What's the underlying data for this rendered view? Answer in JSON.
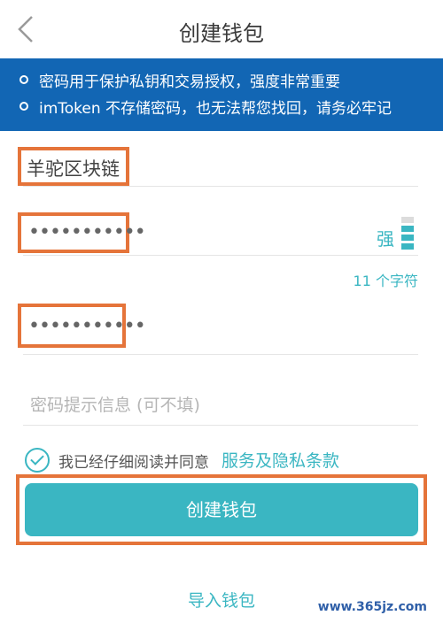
{
  "header": {
    "title": "创建钱包",
    "back_icon": "chevron-left-icon"
  },
  "notice": {
    "items": [
      "密码用于保护私钥和交易授权，强度非常重要",
      "imToken 不存储密码，也无法帮您找回，请务必牢记"
    ],
    "background": "#1266b4"
  },
  "form": {
    "wallet_name": "羊驼区块链",
    "password_masked": "•••••••••••",
    "password_strength": "强",
    "password_strength_level": 3,
    "password_length_text": "11 个字符",
    "confirm_password_masked": "•••••••••••",
    "hint_placeholder": "密码提示信息 (可不填)"
  },
  "agreement": {
    "checked": true,
    "text": "我已经仔细阅读并同意",
    "link_text": "服务及隐私条款"
  },
  "buttons": {
    "create_label": "创建钱包",
    "import_label": "导入钱包"
  },
  "watermark": "www.365jz.com",
  "colors": {
    "accent": "#3ab6c2",
    "highlight": "#e5743a"
  }
}
